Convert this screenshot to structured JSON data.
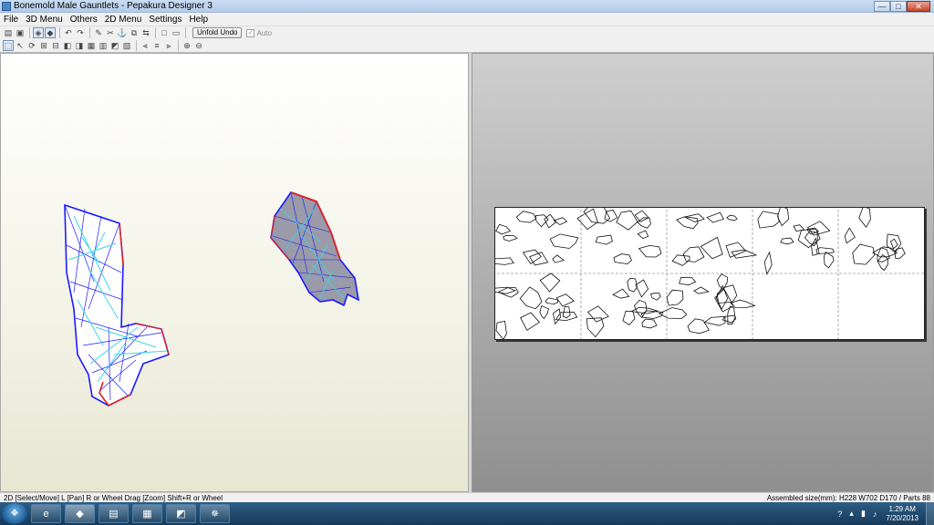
{
  "window": {
    "title": "Bonemold Male Gauntlets - Pepakura Designer 3"
  },
  "window_controls": {
    "minimize": "—",
    "maximize": "□",
    "close": "✕"
  },
  "menu": [
    "File",
    "3D Menu",
    "Others",
    "2D Menu",
    "Settings",
    "Help"
  ],
  "toolbar": {
    "unfold_undo": "Unfold Undo",
    "auto": "Auto",
    "auto_checked": true
  },
  "toolbar_icons_row1": [
    "open-icon",
    "save-icon",
    "3d-view-icon",
    "texture-icon",
    "undo-icon",
    "redo-icon",
    "pencil-icon",
    "cut-icon",
    "anchor-icon",
    "copy-icon",
    "move-icon",
    "window-icon",
    "window-alt-icon"
  ],
  "toolbar_icons_row2": [
    "select-icon",
    "arrow-icon",
    "rotate-icon",
    "join-icon",
    "edge-icon",
    "flap-icon",
    "tab-icon",
    "face-icon",
    "grid-icon",
    "part-icon",
    "layout-icon",
    "align-left-icon",
    "align-center-icon",
    "align-right-icon",
    "zoom-in-icon",
    "zoom-out-icon"
  ],
  "status": {
    "left": "2D [Select/Move] L [Pan] R or Wheel Drag [Zoom] Shift+R or Wheel",
    "right": "Assembled size(mm): H228 W702 D170 / Parts 88"
  },
  "taskbar": {
    "apps": [
      "windows-start-icon",
      "internet-explorer-icon",
      "pepakura-icon",
      "app-green-icon",
      "app-calculator-icon",
      "app-orange-icon",
      "app-pinwheel-icon"
    ],
    "time": "1:29 AM",
    "date": "7/20/2013"
  },
  "colors": {
    "mesh_edge": "#1a1aff",
    "mesh_fold": "#3cd6e6",
    "mesh_cut": "#e02020",
    "mesh_fill": "#9a9aa8"
  }
}
